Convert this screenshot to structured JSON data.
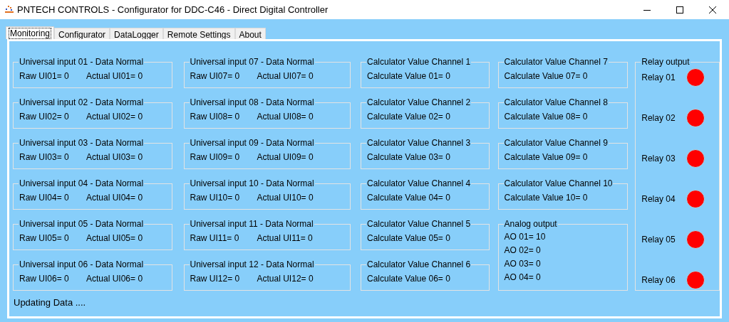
{
  "window": {
    "title": "PNTECH CONTROLS -  Configurator  for DDC-C46 - Direct Digital Controller"
  },
  "tabs": [
    {
      "label": "Monitoring",
      "selected": true
    },
    {
      "label": "Configurator",
      "selected": false
    },
    {
      "label": "DataLogger",
      "selected": false
    },
    {
      "label": "Remote Settings",
      "selected": false
    },
    {
      "label": "About",
      "selected": false
    }
  ],
  "universal_inputs": [
    {
      "title": "Universal input 01 - Data Normal",
      "raw": "Raw UI01= 0",
      "actual": "Actual UI01= 0"
    },
    {
      "title": "Universal input 02 - Data Normal",
      "raw": "Raw UI02= 0",
      "actual": "Actual UI02= 0"
    },
    {
      "title": "Universal input 03 - Data Normal",
      "raw": "Raw UI03= 0",
      "actual": "Actual UI03= 0"
    },
    {
      "title": "Universal input 04 - Data Normal",
      "raw": "Raw UI04= 0",
      "actual": "Actual UI04= 0"
    },
    {
      "title": "Universal input 05 - Data Normal",
      "raw": "Raw UI05= 0",
      "actual": "Actual UI05= 0"
    },
    {
      "title": "Universal input 06 - Data Normal",
      "raw": "Raw UI06= 0",
      "actual": "Actual UI06= 0"
    },
    {
      "title": "Universal input 07 - Data Normal",
      "raw": "Raw UI07= 0",
      "actual": "Actual UI07= 0"
    },
    {
      "title": "Universal input 08 - Data Normal",
      "raw": "Raw UI08= 0",
      "actual": "Actual UI08= 0"
    },
    {
      "title": "Universal input 09 - Data Normal",
      "raw": "Raw UI09= 0",
      "actual": "Actual UI09= 0"
    },
    {
      "title": "Universal input 10 - Data Normal",
      "raw": "Raw UI10= 0",
      "actual": "Actual UI10= 0"
    },
    {
      "title": "Universal input 11 - Data Normal",
      "raw": "Raw UI11= 0",
      "actual": "Actual UI11= 0"
    },
    {
      "title": "Universal input 12 - Data Normal",
      "raw": "Raw UI12= 0",
      "actual": "Actual UI12= 0"
    }
  ],
  "calculator_channels": [
    {
      "title": "Calculator Value Channel 1",
      "value": "Calculate Value 01= 0"
    },
    {
      "title": "Calculator Value Channel 2",
      "value": "Calculate Value 02= 0"
    },
    {
      "title": "Calculator Value Channel 3",
      "value": "Calculate Value 03= 0"
    },
    {
      "title": "Calculator Value Channel 4",
      "value": "Calculate Value 04= 0"
    },
    {
      "title": "Calculator Value Channel 5",
      "value": "Calculate Value 05= 0"
    },
    {
      "title": "Calculator Value Channel 6",
      "value": "Calculate Value 06= 0"
    },
    {
      "title": "Calculator Value Channel 7",
      "value": "Calculate Value 07= 0"
    },
    {
      "title": "Calculator Value Channel 8",
      "value": "Calculate Value 08= 0"
    },
    {
      "title": "Calculator Value Channel 9",
      "value": "Calculate Value 09= 0"
    },
    {
      "title": "Calculator Value Channel 10",
      "value": "Calculate Value 10= 0"
    }
  ],
  "analog_output": {
    "title": "Analog output",
    "values": [
      "AO 01= 10",
      "AO 02= 0",
      "AO 03= 0",
      "AO 04= 0"
    ]
  },
  "relay_output": {
    "title": "Relay output",
    "relays": [
      {
        "label": "Relay 01",
        "color": "#ff0000"
      },
      {
        "label": "Relay 02",
        "color": "#ff0000"
      },
      {
        "label": "Relay 03",
        "color": "#ff0000"
      },
      {
        "label": "Relay 04",
        "color": "#ff0000"
      },
      {
        "label": "Relay 05",
        "color": "#ff0000"
      },
      {
        "label": "Relay 06",
        "color": "#ff0000"
      }
    ]
  },
  "status": "Updating Data ...."
}
